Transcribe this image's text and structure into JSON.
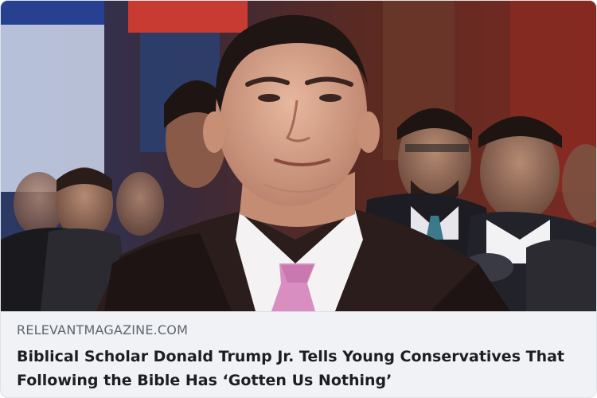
{
  "link_preview": {
    "image_alt_icon": "article-photo",
    "domain": "RELEVANTMAGAZINE.COM",
    "title": "Biblical Scholar Donald Trump Jr. Tells Young Conservatives That Following the Bible Has ‘Gotten Us Nothing’"
  },
  "colors": {
    "card_background": "#f0f2f5",
    "domain_text": "#5f6670",
    "title_text": "#1c1e21"
  }
}
